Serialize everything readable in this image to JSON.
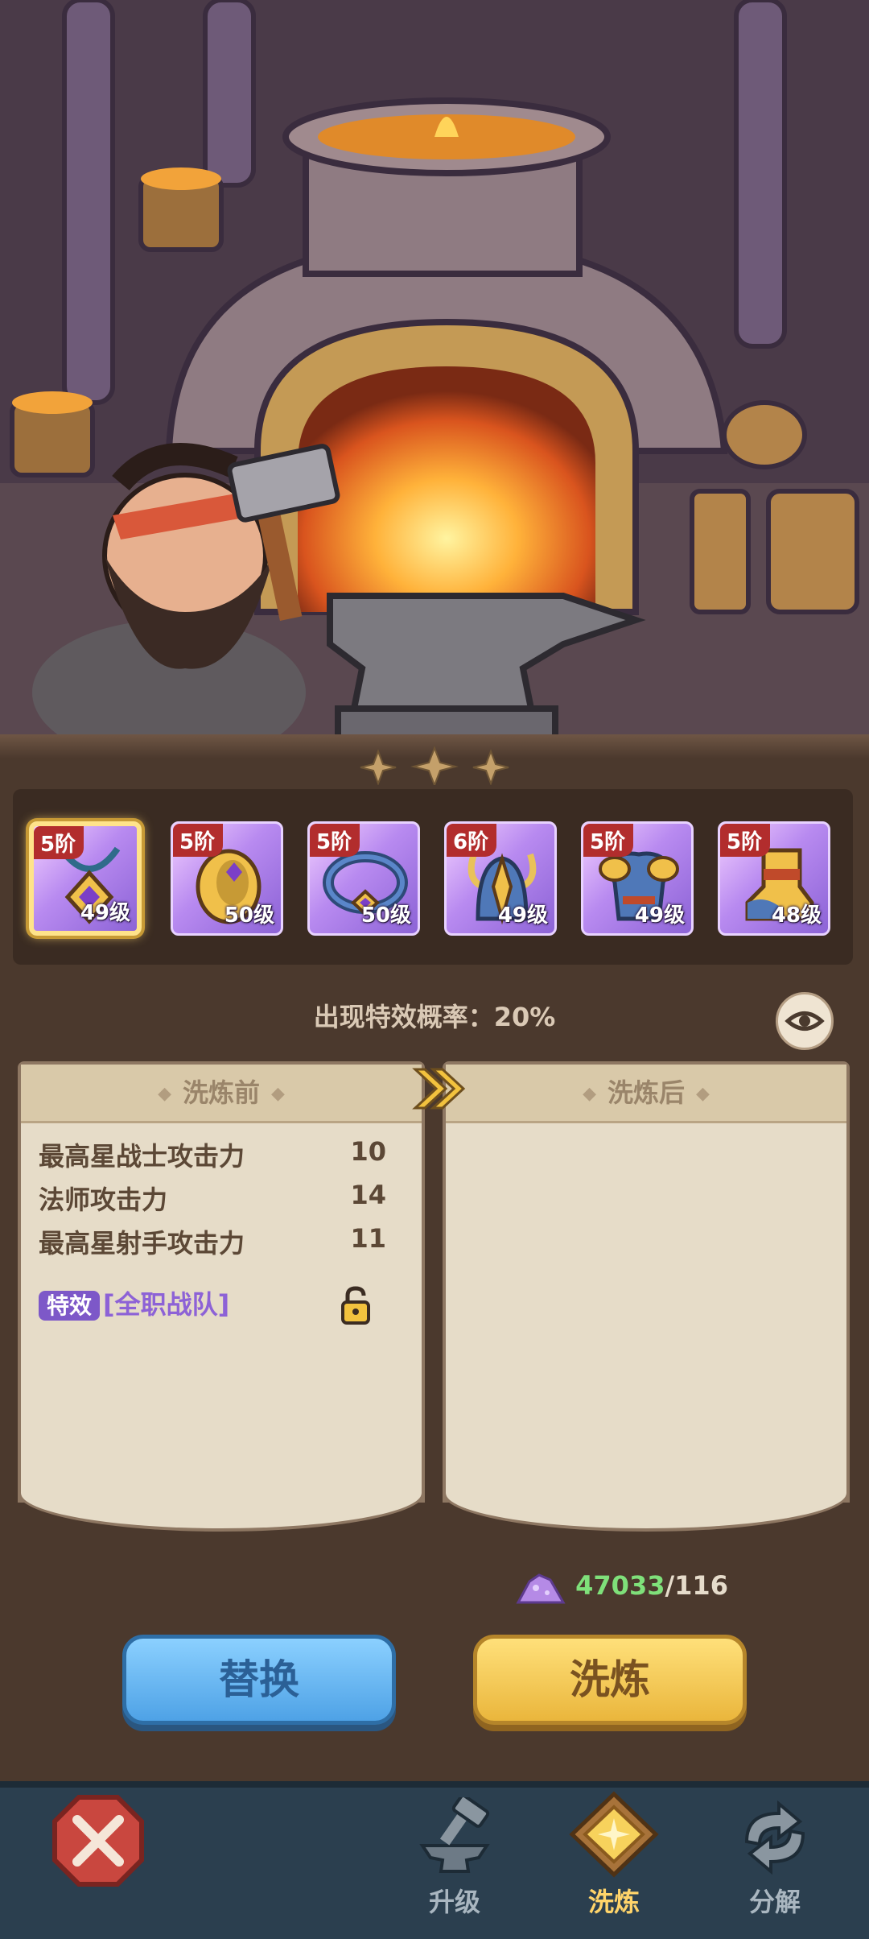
{
  "equipment": [
    {
      "tier": "5阶",
      "level": "49级",
      "icon": "amulet-icon",
      "selected": true
    },
    {
      "tier": "5阶",
      "level": "50级",
      "icon": "gauntlet-icon",
      "selected": false
    },
    {
      "tier": "5阶",
      "level": "50级",
      "icon": "ring-icon",
      "selected": false
    },
    {
      "tier": "6阶",
      "level": "49级",
      "icon": "helmet-icon",
      "selected": false
    },
    {
      "tier": "5阶",
      "level": "49级",
      "icon": "armor-icon",
      "selected": false
    },
    {
      "tier": "5阶",
      "level": "48级",
      "icon": "boots-icon",
      "selected": false
    }
  ],
  "probability_text": "出现特效概率：20%",
  "before": {
    "title": "洗炼前",
    "stats": [
      {
        "name": "最高星战士攻击力",
        "value": "10"
      },
      {
        "name": "法师攻击力",
        "value": "14"
      },
      {
        "name": "最高星射手攻击力",
        "value": "11"
      }
    ],
    "effect_tag": "特效",
    "effect_name": "[全职战队]"
  },
  "after": {
    "title": "洗炼后"
  },
  "currency": {
    "have": "47033",
    "need": "/116",
    "icon": "crystal-dust-icon"
  },
  "buttons": {
    "replace": "替换",
    "refine": "洗炼"
  },
  "nav": {
    "upgrade": "升级",
    "refine": "洗炼",
    "dismantle": "分解",
    "active": "refine"
  },
  "colors": {
    "tier_badge": "#b22d2d",
    "effect_tag": "#7d58c8",
    "currency_have": "#7fe07a",
    "active_nav": "#ffd46a"
  }
}
